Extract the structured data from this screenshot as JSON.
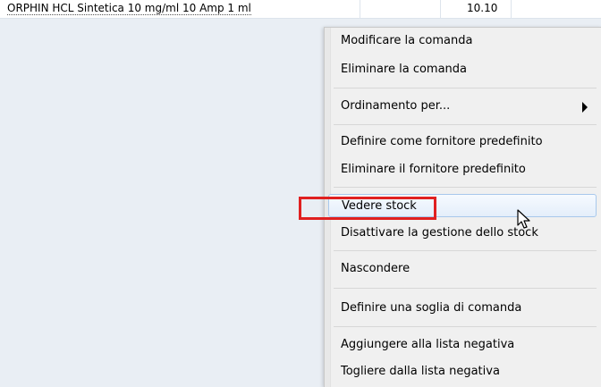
{
  "list": {
    "rows": [
      {
        "name": "ORPHIN HCL Sintetica 10 mg/ml 10 Amp 1 ml",
        "qty": "10.10"
      }
    ]
  },
  "context_menu": {
    "items": [
      {
        "label": "Modificare la comanda"
      },
      {
        "label": "Eliminare la comanda"
      },
      {
        "label": "Ordinamento per...",
        "has_submenu": true
      },
      {
        "label": "Definire come fornitore predefinito"
      },
      {
        "label": "Eliminare il fornitore predefinito"
      },
      {
        "label": "Vedere stock",
        "highlighted": true
      },
      {
        "label": "Disattivare la gestione dello stock"
      },
      {
        "label": "Nascondere"
      },
      {
        "label": "Definire una soglia di comanda"
      },
      {
        "label": "Aggiungere alla lista negativa"
      },
      {
        "label": "Togliere dalla lista negativa"
      }
    ]
  },
  "colors": {
    "highlight_box": "#e02020",
    "hover_border": "#a8c8ec",
    "menu_bg": "#f0f0f0"
  }
}
